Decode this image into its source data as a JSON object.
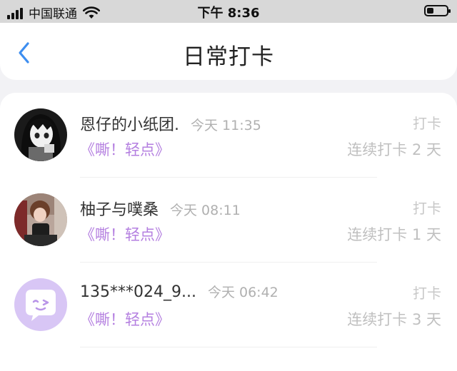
{
  "status_bar": {
    "carrier": "中国联通",
    "time": "下午 8:36"
  },
  "nav": {
    "title": "日常打卡",
    "back_icon": "chevron-left-icon",
    "accent": "#3d8ef0"
  },
  "list": {
    "accent_book": "#b47fe0",
    "items": [
      {
        "username": "恩仔的小纸团.",
        "time": "今天 11:35",
        "book": "《嘶！轻点》",
        "label": "打卡",
        "streak": "连续打卡 2 天",
        "avatar": "anime-avatar"
      },
      {
        "username": "柚子与噗桑",
        "time": "今天 08:11",
        "book": "《嘶！轻点》",
        "label": "打卡",
        "streak": "连续打卡 1 天",
        "avatar": "photo-avatar"
      },
      {
        "username": "135***024_9...",
        "time": "今天 06:42",
        "book": "《嘶！轻点》",
        "label": "打卡",
        "streak": "连续打卡 3 天",
        "avatar": "chat-bubble-avatar"
      }
    ]
  }
}
